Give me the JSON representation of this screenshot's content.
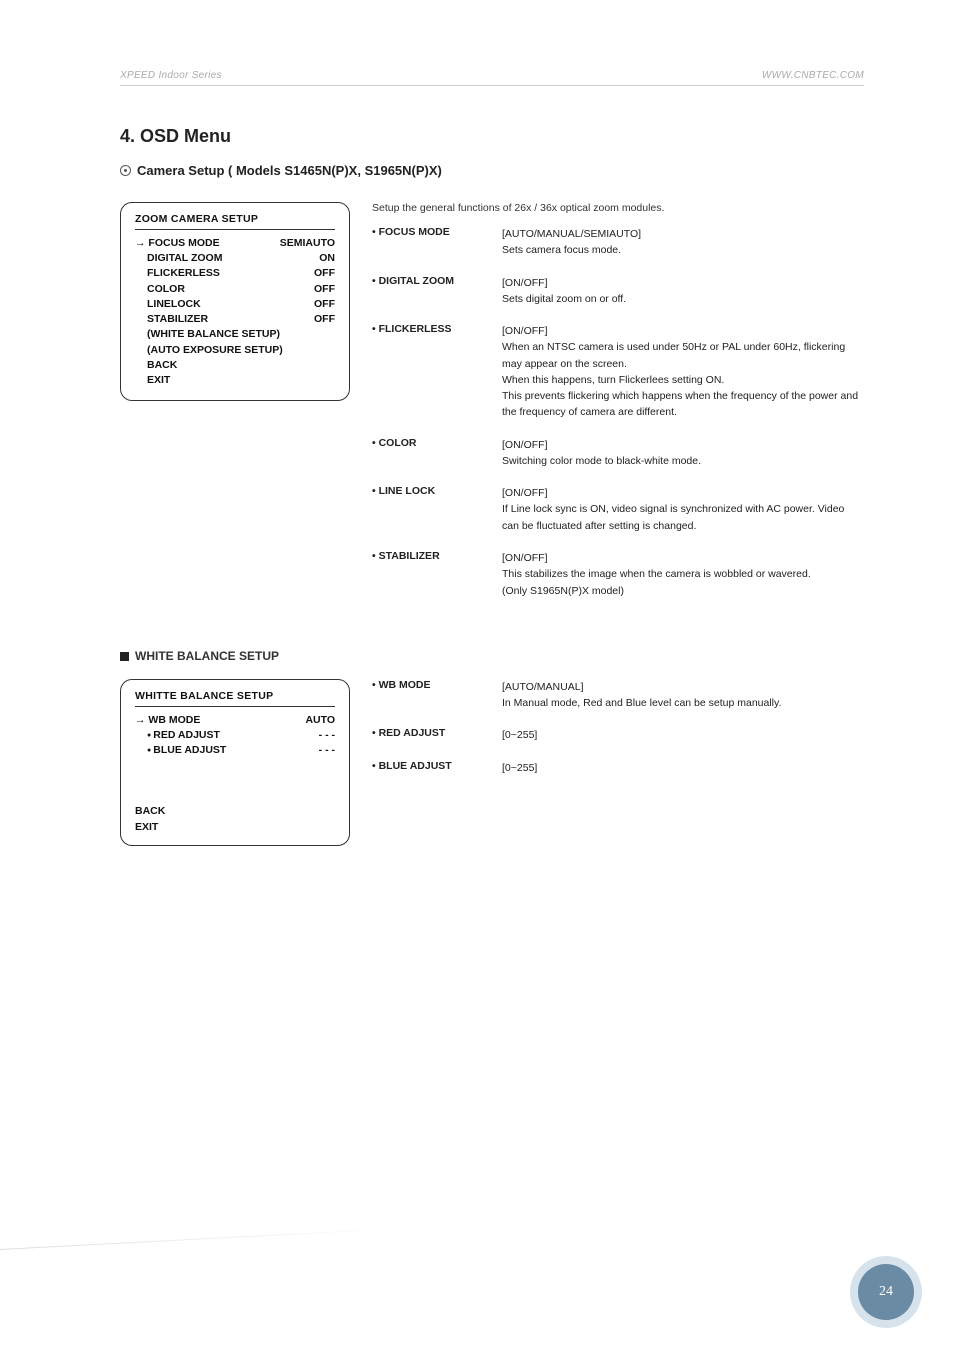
{
  "header": {
    "left": "XPEED Indoor Series",
    "right": "WWW.CNBTEC.COM"
  },
  "section_title": "4. OSD Menu",
  "subsection": "Camera Setup ( Models S1465N(P)X, S1965N(P)X)",
  "zoom_box": {
    "title": "ZOOM CAMERA SETUP",
    "rows": [
      {
        "k": "FOCUS MODE",
        "v": "SEMIAUTO",
        "sel": true
      },
      {
        "k": "DIGITAL ZOOM",
        "v": "ON"
      },
      {
        "k": "FLICKERLESS",
        "v": "OFF"
      },
      {
        "k": "COLOR",
        "v": "OFF"
      },
      {
        "k": "LINELOCK",
        "v": "OFF"
      },
      {
        "k": "STABILIZER",
        "v": "OFF"
      },
      {
        "k": "(WHITE BALANCE SETUP)",
        "v": ""
      },
      {
        "k": "(AUTO EXPOSURE SETUP)",
        "v": ""
      },
      {
        "k": "BACK",
        "v": ""
      },
      {
        "k": "EXIT",
        "v": ""
      }
    ]
  },
  "intro": "Setup the general functions of 26x / 36x optical zoom modules.",
  "items": [
    {
      "label": "FOCUS MODE",
      "lines": [
        "[AUTO/MANUAL/SEMIAUTO]",
        "Sets camera focus mode."
      ]
    },
    {
      "label": "DIGITAL ZOOM",
      "lines": [
        "[ON/OFF]",
        "Sets digital zoom on or off."
      ]
    },
    {
      "label": "FLICKERLESS",
      "lines": [
        "[ON/OFF]",
        "When an NTSC camera is used under 50Hz or PAL under 60Hz, flickering may appear on the screen.",
        "When this happens, turn Flickerlees setting ON.",
        "This prevents flickering which happens when the frequency of the power and the frequency of camera are different."
      ]
    },
    {
      "label": "COLOR",
      "lines": [
        "[ON/OFF]",
        "Switching color mode to black-white mode."
      ]
    },
    {
      "label": "LINE LOCK",
      "lines": [
        "[ON/OFF]",
        "If Line lock sync is ON, video signal is synchronized with AC power. Video can be fluctuated after setting is changed."
      ]
    },
    {
      "label": "STABILIZER",
      "lines": [
        "[ON/OFF]",
        "This stabilizes the image when the camera is wobbled or wavered.",
        "(Only S1965N(P)X model)"
      ]
    }
  ],
  "wb_heading": "WHITE BALANCE SETUP",
  "wb_box": {
    "title": "WHITTE BALANCE SETUP",
    "rows": [
      {
        "k": "WB MODE",
        "v": "AUTO",
        "sel": true
      },
      {
        "k": "RED ADJUST",
        "v": "- - -",
        "dot": true
      },
      {
        "k": "BLUE ADJUST",
        "v": "- - -",
        "dot": true
      }
    ],
    "footer": [
      "BACK",
      "EXIT"
    ]
  },
  "wb_items": [
    {
      "label": "WB MODE",
      "lines": [
        "[AUTO/MANUAL]",
        "In Manual mode, Red and Blue level can be setup manually."
      ]
    },
    {
      "label": "RED ADJUST",
      "lines": [
        "[0~255]"
      ]
    },
    {
      "label": "BLUE ADJUST",
      "lines": [
        "[0~255]"
      ]
    }
  ],
  "page_number": "24"
}
